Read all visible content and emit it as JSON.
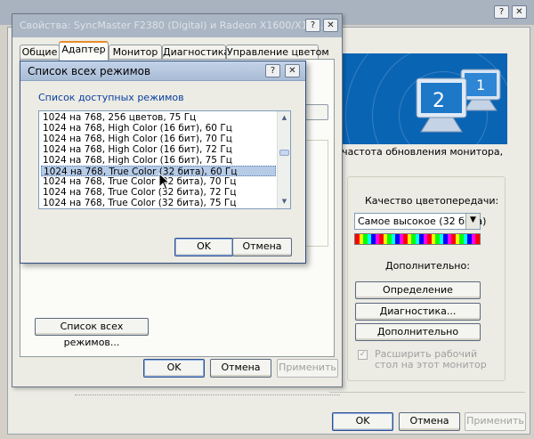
{
  "background_window": {
    "info_text": "и, частота обновления монитора,",
    "quality_label": "Качество цветопередачи:",
    "quality_value": "Самое высокое (32 бита)",
    "extra_label": "Дополнительно:",
    "buttons": [
      "Определение",
      "Диагностика...",
      "Дополнительно"
    ],
    "accept_label": "Расширить рабочий стол на этот монитор",
    "ok": "OK",
    "cancel": "Отмена",
    "apply": "Применить",
    "monitor_numbers": [
      "1",
      "2"
    ]
  },
  "properties_dialog": {
    "title": "Свойства: SyncMaster F2380 (Digital) и Radeon X1600/X16...",
    "tabs": [
      "Общие",
      "Адаптер",
      "Монитор",
      "Диагностика",
      "Управление цветом"
    ],
    "active_tab": "Адаптер",
    "list_all_modes_button": "Список всех режимов...",
    "ok": "OK",
    "cancel": "Отмена",
    "apply": "Применить"
  },
  "modes_dialog": {
    "title": "Список всех режимов",
    "list_label": "Список доступных режимов",
    "modes": [
      "1024 на 768, 256 цветов, 75 Гц",
      "1024 на 768, High Color (16 бит), 60 Гц",
      "1024 на 768, High Color (16 бит), 70 Гц",
      "1024 на 768, High Color (16 бит), 72 Гц",
      "1024 на 768, High Color (16 бит), 75 Гц",
      "1024 на 768, True Color (32 бита), 60 Гц",
      "1024 на 768, True Color (32 бита), 70 Гц",
      "1024 на 768, True Color (32 бита), 72 Гц",
      "1024 на 768, True Color (32 бита), 75 Гц"
    ],
    "selected_index": 5,
    "ok": "OK",
    "cancel": "Отмена"
  },
  "titlebar_buttons": {
    "help": "?",
    "close": "✕",
    "minimize": "_"
  },
  "colors": {
    "accent": "#0a64b4",
    "selection": "#b6cbe6",
    "link": "#0b3fa0",
    "active_tab": "#e68b2c"
  }
}
